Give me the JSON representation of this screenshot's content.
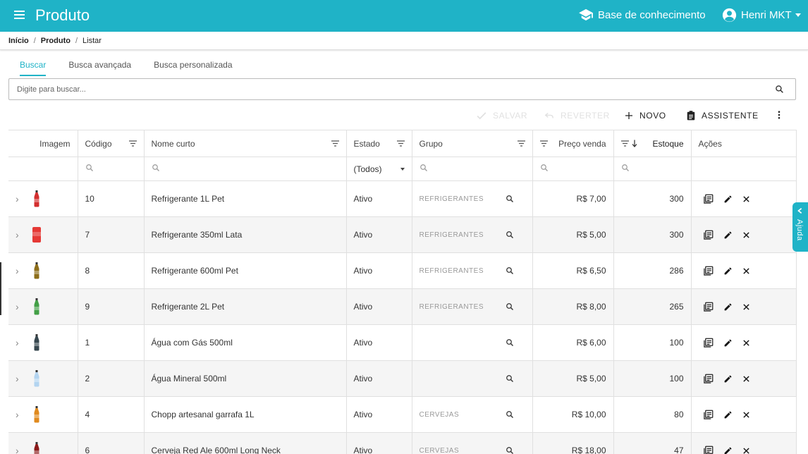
{
  "app": {
    "title": "Produto",
    "knowledge_base": "Base de conhecimento",
    "user": "Henri MKT"
  },
  "breadcrumb": [
    "Início",
    "Produto",
    "Listar"
  ],
  "tabs": [
    "Buscar",
    "Busca avançada",
    "Busca personalizada"
  ],
  "search": {
    "placeholder": "Digite para buscar..."
  },
  "toolbar": {
    "save": "Salvar",
    "revert": "Reverter",
    "new": "Novo",
    "assistant": "Assistente"
  },
  "columns": {
    "image": "Imagem",
    "code": "Código",
    "short_name": "Nome curto",
    "state": "Estado",
    "group": "Grupo",
    "price": "Preço venda",
    "stock": "Estoque",
    "actions": "Ações"
  },
  "filters": {
    "state": "(Todos)"
  },
  "rows": [
    {
      "code": "10",
      "name": "Refrigerante 1L Pet",
      "state": "Ativo",
      "group": "REFRIGERANTES",
      "price": "R$ 7,00",
      "stock": "300",
      "img_color": "#d32f2f",
      "img_shape": "bottle"
    },
    {
      "code": "7",
      "name": "Refrigerante 350ml Lata",
      "state": "Ativo",
      "group": "REFRIGERANTES",
      "price": "R$ 5,00",
      "stock": "300",
      "img_color": "#e53935",
      "img_shape": "can"
    },
    {
      "code": "8",
      "name": "Refrigerante 600ml Pet",
      "state": "Ativo",
      "group": "REFRIGERANTES",
      "price": "R$ 6,50",
      "stock": "286",
      "img_color": "#8d6e1a",
      "img_shape": "bottle"
    },
    {
      "code": "9",
      "name": "Refrigerante 2L Pet",
      "state": "Ativo",
      "group": "REFRIGERANTES",
      "price": "R$ 8,00",
      "stock": "265",
      "img_color": "#43a047",
      "img_shape": "bottle"
    },
    {
      "code": "1",
      "name": "Água com Gás 500ml",
      "state": "Ativo",
      "group": "",
      "price": "R$ 6,00",
      "stock": "100",
      "img_color": "#37474f",
      "img_shape": "bottle"
    },
    {
      "code": "2",
      "name": "Água Mineral 500ml",
      "state": "Ativo",
      "group": "",
      "price": "R$ 5,00",
      "stock": "100",
      "img_color": "#b3d4f0",
      "img_shape": "bottle"
    },
    {
      "code": "4",
      "name": "Chopp artesanal garrafa 1L",
      "state": "Ativo",
      "group": "CERVEJAS",
      "price": "R$ 10,00",
      "stock": "80",
      "img_color": "#e08a1e",
      "img_shape": "bottle"
    },
    {
      "code": "6",
      "name": "Cerveja Red Ale 600ml Long Neck",
      "state": "Ativo",
      "group": "CERVEJAS",
      "price": "R$ 18,00",
      "stock": "47",
      "img_color": "#8b1a1a",
      "img_shape": "bottle"
    }
  ],
  "help": {
    "label": "Ajuda"
  },
  "colors": {
    "primary": "#1fb3c7"
  }
}
